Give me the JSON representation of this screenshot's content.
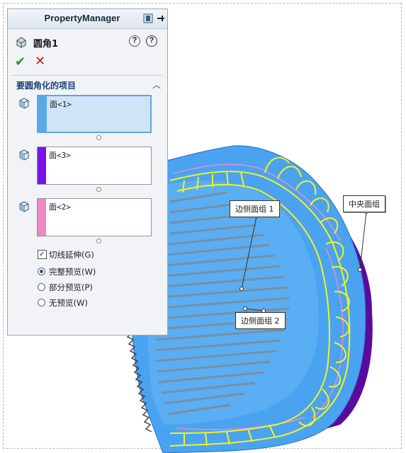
{
  "property_manager": {
    "title": "PropertyManager",
    "feature_name": "圆角1",
    "group_title": "要圆角化的项目",
    "selections": [
      {
        "label": "面<1>",
        "color": "#5aa9e6",
        "active": true
      },
      {
        "label": "面<3>",
        "color": "#7a13e6",
        "active": false
      },
      {
        "label": "面<2>",
        "color": "#ef86c0",
        "active": false
      }
    ],
    "tangent_propagation": {
      "label": "切线延伸(G)",
      "checked": true
    },
    "preview_options": [
      {
        "label": "完整预览(W)",
        "selected": true
      },
      {
        "label": "部分预览(P)",
        "selected": false
      },
      {
        "label": "无预览(W)",
        "selected": false
      }
    ]
  },
  "callouts": {
    "side_group_1": "边侧面组 1",
    "center_group": "中央面组",
    "side_group_2": "边侧面组 2"
  },
  "colors": {
    "model_blue": "#4aa3f0",
    "model_purple": "#5a0a9e",
    "preview_yellow": "#f2f21e",
    "preview_pink": "#e88ad2"
  },
  "icons": [
    "fillet-feature-icon",
    "pin-icon",
    "thumbtack-icon",
    "help-tip-icon",
    "help-icon",
    "ok-check-icon",
    "cancel-x-icon",
    "collapse-chevron-icon",
    "face-selection-icon"
  ]
}
